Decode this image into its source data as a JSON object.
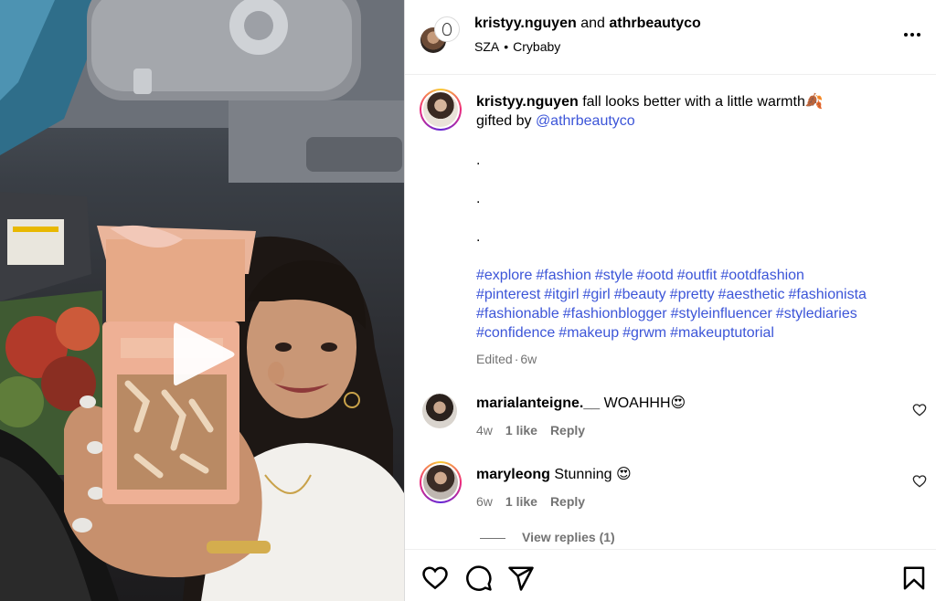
{
  "post": {
    "author": "kristyy.nguyen",
    "joiner": "and",
    "coauthor": "athrbeautyco",
    "audio": {
      "artist": "SZA",
      "separator": "•",
      "song": "Crybaby"
    }
  },
  "caption": {
    "username": "kristyy.nguyen",
    "text": "fall looks better with a little warmth🍂",
    "line2_prefix": "gifted by",
    "mention": "@athrbeautyco",
    "bullets": [
      ".",
      ".",
      "."
    ],
    "hashtags": [
      "#explore",
      "#fashion",
      "#style",
      "#ootd",
      "#outfit",
      "#ootdfashion",
      "#pinterest",
      "#itgirl",
      "#girl",
      "#beauty",
      "#pretty",
      "#aesthetic",
      "#fashionista",
      "#fashionable",
      "#fashionblogger",
      "#styleinfluencer",
      "#stylediaries",
      "#confidence",
      "#makeup",
      "#grwm",
      "#makeuptutorial"
    ],
    "edited": "Edited",
    "separator": "·",
    "age": "6w"
  },
  "comments": [
    {
      "username": "marialanteigne.__",
      "text": "WOAHHH😍",
      "age": "4w",
      "likes": "1 like",
      "reply": "Reply"
    },
    {
      "username": "maryleong",
      "text": "Stunning 😍",
      "age": "6w",
      "likes": "1 like",
      "reply": "Reply"
    }
  ],
  "view_replies": "View replies (1)",
  "icons": {
    "play": "play-icon",
    "more": "more-options-icon",
    "like": "heart-icon",
    "comment": "comment-icon",
    "share": "send-icon",
    "save": "bookmark-icon"
  }
}
